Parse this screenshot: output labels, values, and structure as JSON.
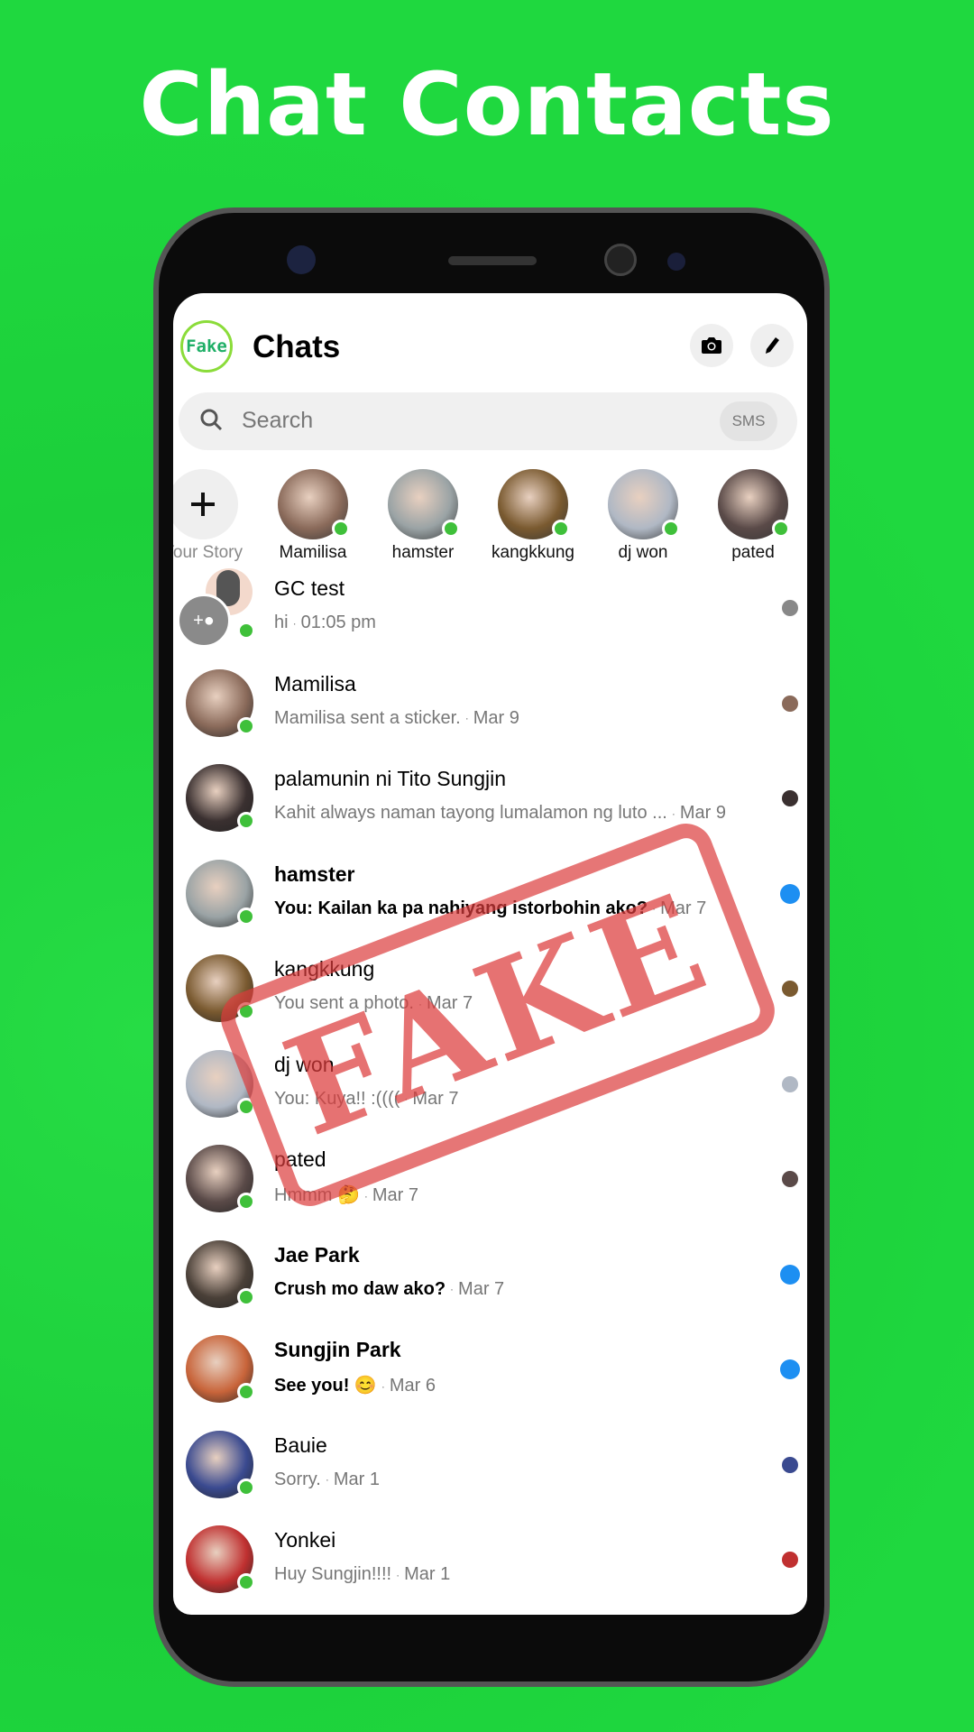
{
  "banner": {
    "title": "Chat Contacts"
  },
  "header": {
    "logo": "Fake",
    "title": "Chats",
    "camera_icon": "camera-icon",
    "compose_icon": "pencil-icon"
  },
  "search": {
    "placeholder": "Search",
    "sms_label": "SMS"
  },
  "stories": [
    {
      "label": "Your Story",
      "add": true
    },
    {
      "label": "Mamilisa",
      "color": "#8a6a5a"
    },
    {
      "label": "hamster",
      "color": "#9aa3a5"
    },
    {
      "label": "kangkkung",
      "color": "#7a5a30"
    },
    {
      "label": "dj won",
      "color": "#b0b8c4"
    },
    {
      "label": "pated",
      "color": "#5a4a48"
    }
  ],
  "chats": [
    {
      "name": "GC test",
      "message": "hi",
      "time": "01:05 pm",
      "unread": false,
      "group": true,
      "color": "#888"
    },
    {
      "name": "Mamilisa",
      "message": "Mamilisa sent a sticker.",
      "time": "Mar 9",
      "unread": false,
      "color": "#8a6a5a"
    },
    {
      "name": "palamunin ni Tito Sungjin",
      "message": "Kahit always naman tayong lumalamon ng luto ...",
      "time": "Mar 9",
      "unread": false,
      "color": "#3a3030"
    },
    {
      "name": "hamster",
      "message": "You: Kailan ka pa nahiyang istorbohin ako?",
      "time": "Mar 7",
      "unread": true,
      "color": "#9aa3a5"
    },
    {
      "name": "kangkkung",
      "message": "You sent a photo.",
      "time": "Mar 7",
      "unread": false,
      "color": "#7a5a30"
    },
    {
      "name": "dj won",
      "message": "You: Kuya!! :((((",
      "time": "Mar 7",
      "unread": false,
      "color": "#b0b8c4"
    },
    {
      "name": "pated",
      "message": "Hmmm 🤔",
      "time": "Mar 7",
      "unread": false,
      "color": "#5a4a48"
    },
    {
      "name": "Jae Park",
      "message": "Crush mo daw ako?",
      "time": "Mar 7",
      "unread": true,
      "color": "#4a4038"
    },
    {
      "name": "Sungjin Park",
      "message": "See you! 😊",
      "time": "Mar 6",
      "unread": true,
      "color": "#c8643a"
    },
    {
      "name": "Bauie",
      "message": "Sorry.",
      "time": "Mar 1",
      "unread": false,
      "color": "#3a4a90"
    },
    {
      "name": "Yonkei",
      "message": "Huy Sungjin!!!!",
      "time": "Mar 1",
      "unread": false,
      "color": "#c03030"
    }
  ],
  "stamp": {
    "text": "FAKE",
    "color": "#dc3c3c"
  },
  "colors": {
    "background": "#1fd83f",
    "online": "#3fc03a",
    "unread": "#1d8ff2"
  }
}
